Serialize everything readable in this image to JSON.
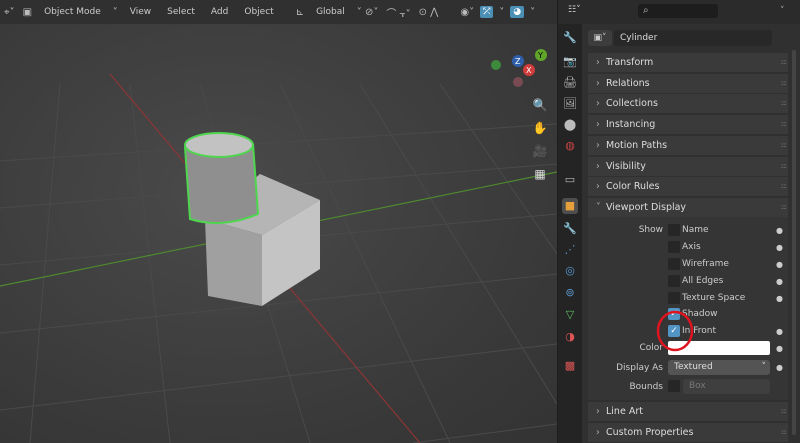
{
  "toolbar": {
    "mode": "Object Mode",
    "menus": [
      "View",
      "Select",
      "Add",
      "Object"
    ],
    "orientation": "Global"
  },
  "viewport": {
    "gizmo": {
      "x": "X",
      "y": "Y",
      "z": "Z"
    },
    "nav_icons": [
      "zoom-icon",
      "hand-icon",
      "camera-icon",
      "grid-icon"
    ]
  },
  "properties": {
    "search_placeholder": "",
    "object_name": "Cylinder",
    "sections": [
      "Transform",
      "Relations",
      "Collections",
      "Instancing",
      "Motion Paths",
      "Visibility",
      "Color Rules",
      "Viewport Display"
    ],
    "viewport_display": {
      "show_label": "Show",
      "checks": [
        {
          "label": "Name",
          "checked": false
        },
        {
          "label": "Axis",
          "checked": false
        },
        {
          "label": "Wireframe",
          "checked": false
        },
        {
          "label": "All Edges",
          "checked": false
        },
        {
          "label": "Texture Space",
          "checked": false
        },
        {
          "label": "Shadow",
          "checked": true
        },
        {
          "label": "In Front",
          "checked": true
        }
      ],
      "color_label": "Color",
      "color_value": "#ffffff",
      "display_as_label": "Display As",
      "display_as": "Textured",
      "bounds_label": "Bounds",
      "bounds_value": "Box"
    },
    "sections_after": [
      "Line Art",
      "Custom Properties"
    ]
  },
  "annotation": {
    "circle_color": "#e0141e"
  }
}
